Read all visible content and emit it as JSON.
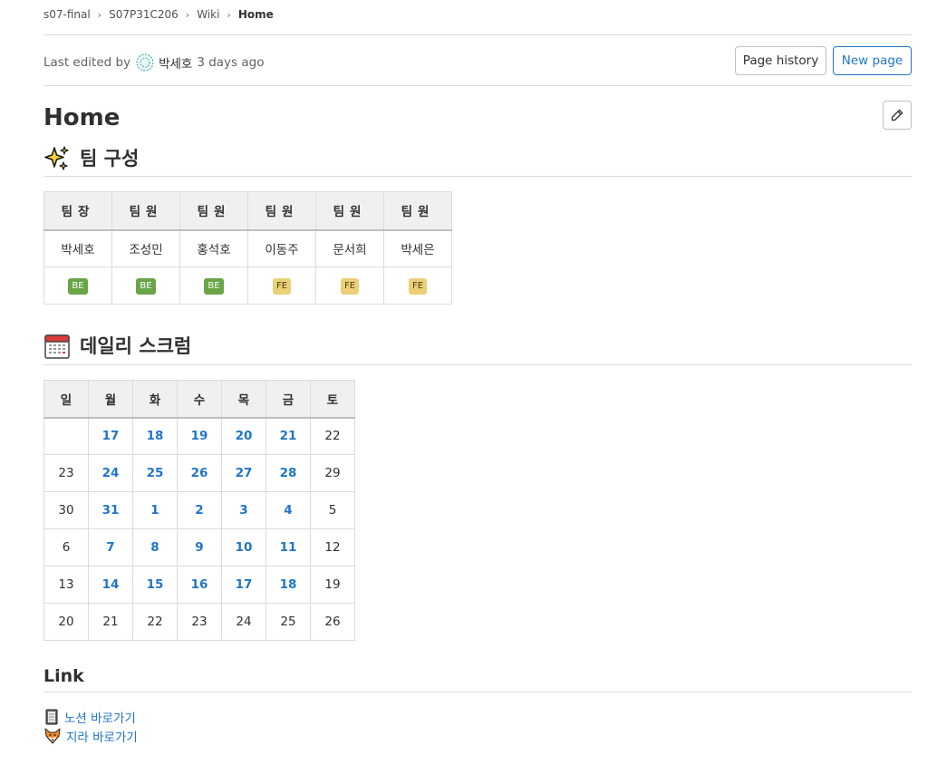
{
  "breadcrumb": [
    "s07-final",
    "S07P31C206",
    "Wiki",
    "Home"
  ],
  "meta": {
    "prefix": "Last edited by",
    "author": "박세호",
    "time": "3 days ago"
  },
  "buttons": {
    "history": "Page history",
    "new_page": "New page"
  },
  "page_title": "Home",
  "team_section": {
    "title": "팀 구성",
    "emoji_icon": "sparkles-icon"
  },
  "team": {
    "roles": [
      "팀장",
      "팀원",
      "팀원",
      "팀원",
      "팀원",
      "팀원"
    ],
    "names": [
      "박세호",
      "조성민",
      "홍석호",
      "이동주",
      "문서희",
      "박세은"
    ],
    "badges": [
      "BE",
      "BE",
      "BE",
      "FE",
      "FE",
      "FE"
    ]
  },
  "badge_colors": {
    "BE": "#69a547",
    "FE": "#ebd078"
  },
  "scrum_section": {
    "title": "데일리 스크럼",
    "emoji_icon": "calendar-icon"
  },
  "calendar": {
    "headers": [
      "일",
      "월",
      "화",
      "수",
      "목",
      "금",
      "토"
    ],
    "rows": [
      [
        "",
        "17",
        "18",
        "19",
        "20",
        "21",
        "22"
      ],
      [
        "23",
        "24",
        "25",
        "26",
        "27",
        "28",
        "29"
      ],
      [
        "30",
        "31",
        "1",
        "2",
        "3",
        "4",
        "5"
      ],
      [
        "6",
        "7",
        "8",
        "9",
        "10",
        "11",
        "12"
      ],
      [
        "13",
        "14",
        "15",
        "16",
        "17",
        "18",
        "19"
      ],
      [
        "20",
        "21",
        "22",
        "23",
        "24",
        "25",
        "26"
      ]
    ],
    "linked_rows": [
      0,
      1,
      2,
      3,
      4
    ],
    "linked_cols": [
      1,
      2,
      3,
      4,
      5
    ]
  },
  "link_section": {
    "title": "Link",
    "items": [
      {
        "icon": "notebook-icon",
        "label": "노션 바로가기"
      },
      {
        "icon": "fox-icon",
        "label": "지라 바로가기"
      }
    ]
  },
  "colors": {
    "link": "#1f75cb",
    "border": "#dcdcde",
    "header_bg": "#f0f0f0"
  }
}
